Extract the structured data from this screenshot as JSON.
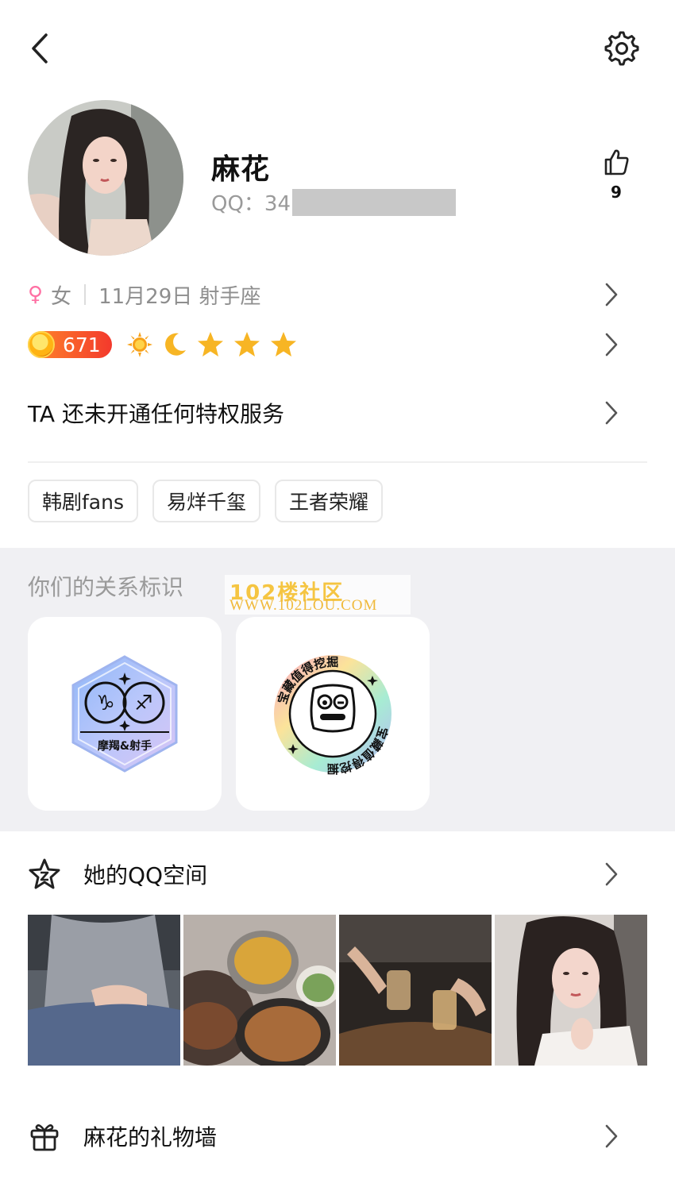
{
  "profile": {
    "name": "麻花",
    "qq_label": "QQ：34",
    "likes": "9"
  },
  "info": {
    "gender_symbol": "♀",
    "gender": "女",
    "birthday": "11月29日 射手座"
  },
  "level": {
    "value": "671",
    "icons": [
      "sun-icon",
      "moon-icon",
      "star-icon",
      "star-icon",
      "star-icon"
    ]
  },
  "privilege": {
    "text": "TA 还未开通任何特权服务"
  },
  "tags": [
    "韩剧fans",
    "易烊千玺",
    "王者荣耀"
  ],
  "relation": {
    "title": "你们的关系标识",
    "watermark_line1": "102楼社区",
    "watermark_line2": "WWW.102LOU.COM",
    "badges": [
      {
        "label": "摩羯&射手",
        "icon": "capricorn-sagittarius-badge"
      },
      {
        "label": "宝藏值得挖掘",
        "icon": "treasure-badge"
      }
    ]
  },
  "space": {
    "title": "她的QQ空间",
    "photos": [
      "photo-1",
      "photo-2",
      "photo-3",
      "photo-4"
    ]
  },
  "gifts": {
    "title": "麻花的礼物墙"
  },
  "colors": {
    "accent_pink": "#ff6fa3",
    "level_gradient_start": "#ff8a2a",
    "level_gradient_end": "#f3392c",
    "star": "#f7b524",
    "section_bg": "#f0f0f3"
  }
}
